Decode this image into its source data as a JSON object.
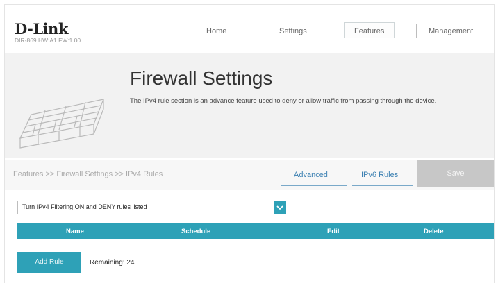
{
  "header": {
    "logo": "D-Link",
    "model": "DIR-869 HW:A1 FW:1.00",
    "nav": {
      "home": "Home",
      "settings": "Settings",
      "features": "Features",
      "management": "Management"
    }
  },
  "banner": {
    "title": "Firewall Settings",
    "description": "The IPv4 rule section is an advance feature used to deny or allow traffic from passing through the device."
  },
  "breadcrumb": "Features >> Firewall Settings >> IPv4 Rules",
  "links": {
    "advanced": "Advanced",
    "ipv6": "IPv6 Rules"
  },
  "save_label": "Save",
  "filter": {
    "selected": "Turn IPv4 Filtering ON and DENY rules listed"
  },
  "table": {
    "columns": [
      "Name",
      "Schedule",
      "Edit",
      "Delete"
    ]
  },
  "add_rule_label": "Add Rule",
  "remaining_text": "Remaining: 24",
  "colors": {
    "accent": "#2ea1b7",
    "save_disabled": "#c7c7c7"
  }
}
